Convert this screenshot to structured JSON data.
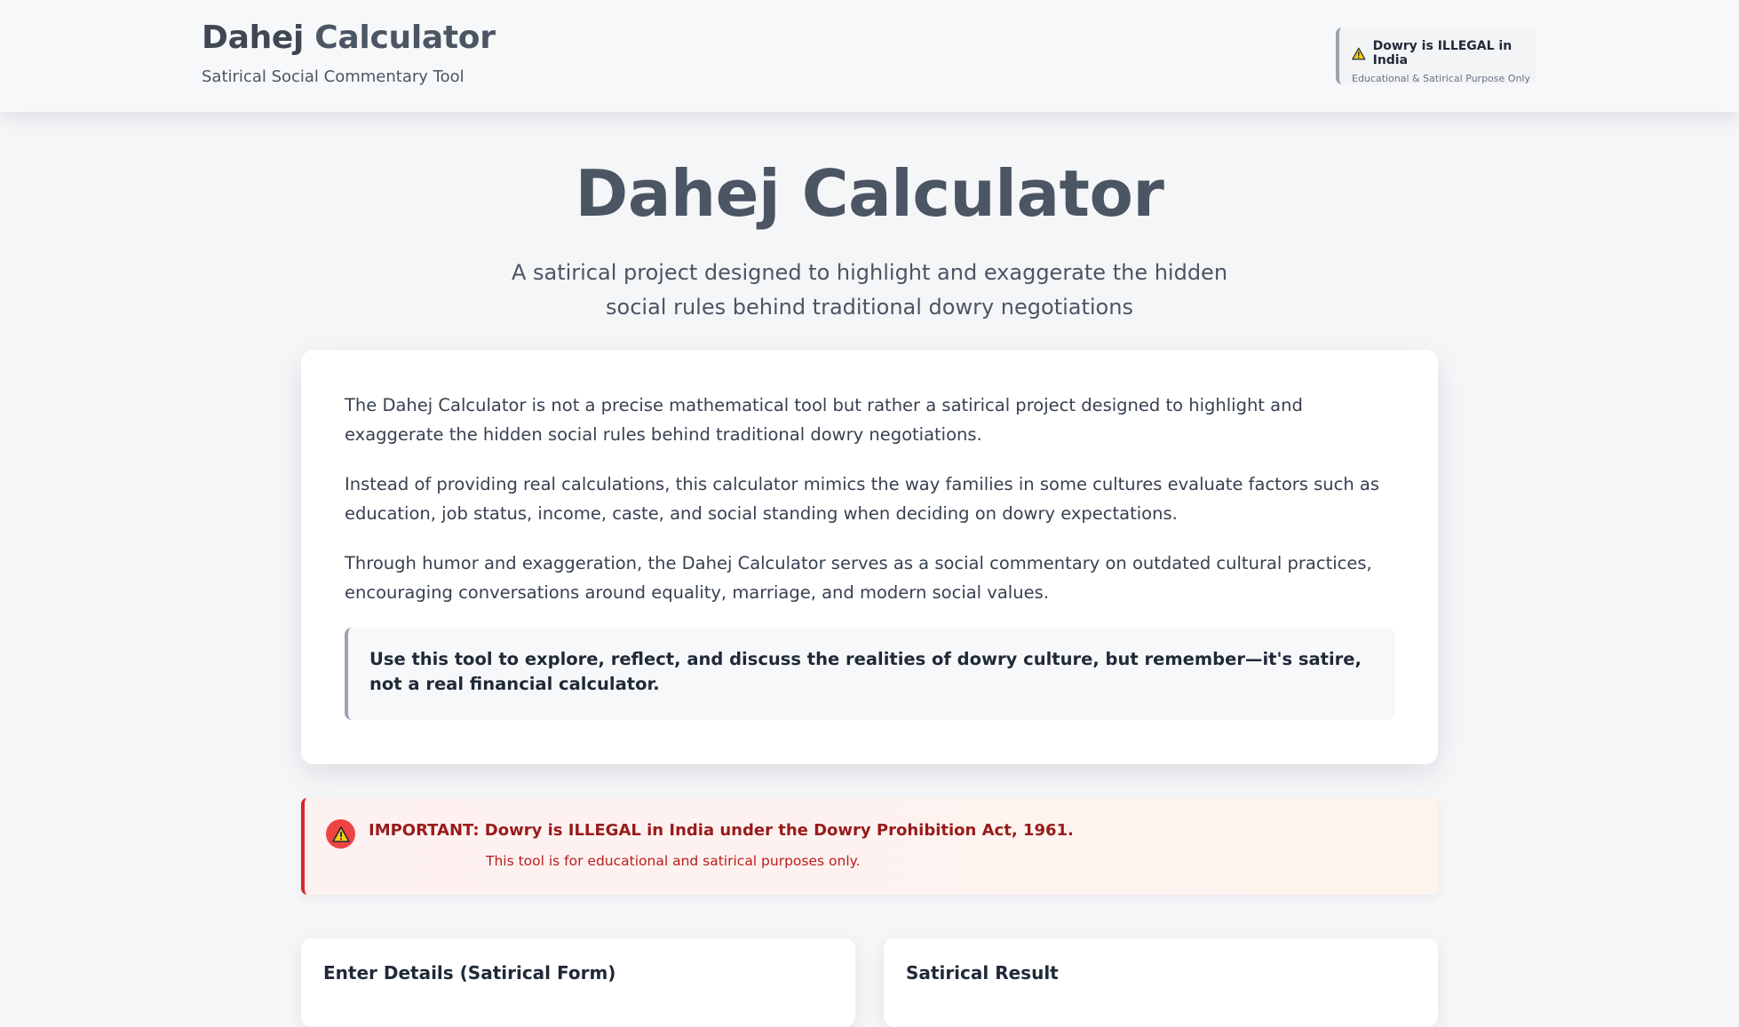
{
  "header": {
    "brand_part1": "Dahej",
    "brand_part2": " Calculator",
    "tagline": "Satirical Social Commentary Tool",
    "badge_title": "Dowry is ILLEGAL in India",
    "badge_subtitle": "Educational & Satirical Purpose Only"
  },
  "hero": {
    "title": "Dahej Calculator",
    "subtitle": "A satirical project designed to highlight and exaggerate the hidden social rules behind traditional dowry negotiations"
  },
  "intro_card": {
    "paragraphs": [
      "The Dahej Calculator is not a precise mathematical tool but rather a satirical project designed to highlight and exaggerate the hidden social rules behind traditional dowry negotiations.",
      "Instead of providing real calculations, this calculator mimics the way families in some cultures evaluate factors such as education, job status, income, caste, and social standing when deciding on dowry expectations.",
      "Through humor and exaggeration, the Dahej Calculator serves as a social commentary on outdated cultural practices, encouraging conversations around equality, marriage, and modern social values."
    ],
    "quote": "Use this tool to explore, reflect, and discuss the realities of dowry culture, but remember—it's satire, not a real financial calculator."
  },
  "alert": {
    "title": "IMPORTANT: Dowry is ILLEGAL in India under the Dowry Prohibition Act, 1961.",
    "subtitle": "This tool is for educational and satirical purposes only."
  },
  "panels": {
    "form_title": "Enter Details (Satirical Form)",
    "result_title": "Satirical Result"
  },
  "colors": {
    "alert_accent": "#dc2626",
    "alert_text": "#991b1b",
    "warning_yellow": "#facc15"
  }
}
